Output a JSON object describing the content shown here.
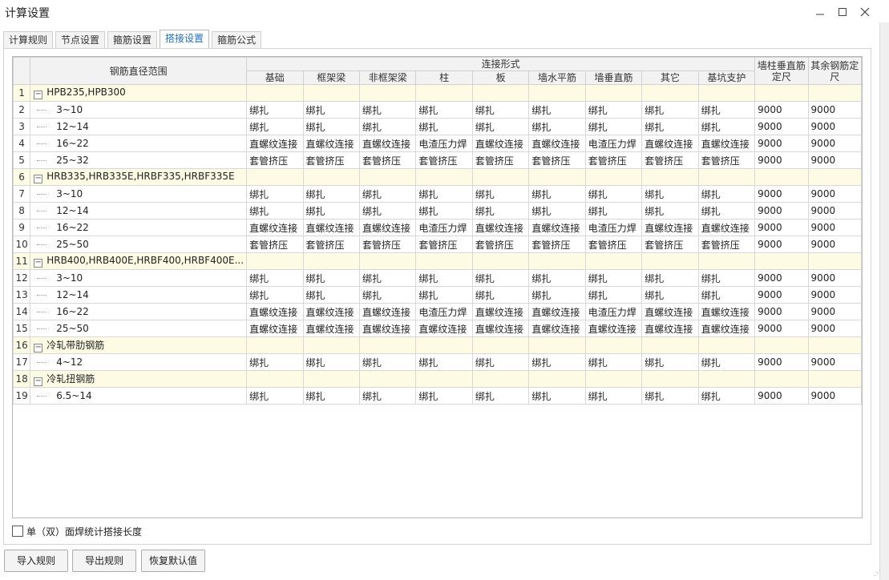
{
  "window": {
    "title": "计算设置"
  },
  "tabs": [
    {
      "label": "计算规则"
    },
    {
      "label": "节点设置"
    },
    {
      "label": "箍筋设置"
    },
    {
      "label": "搭接设置",
      "active": true
    },
    {
      "label": "箍筋公式"
    }
  ],
  "grid": {
    "col_range": "钢筋直径范围",
    "col_connect": "连接形式",
    "sub_headers": [
      "基础",
      "框架梁",
      "非框架梁",
      "柱",
      "板",
      "墙水平筋",
      "墙垂直筋",
      "其它",
      "基坑支护"
    ],
    "col_wall_vertical_length": "墙柱垂直筋定尺",
    "col_other_length": "其余钢筋定尺",
    "rows": [
      {
        "num": "1",
        "group": true,
        "name": "HPB235,HPB300"
      },
      {
        "num": "2",
        "name": "3~10",
        "values": [
          "绑扎",
          "绑扎",
          "绑扎",
          "绑扎",
          "绑扎",
          "绑扎",
          "绑扎",
          "绑扎",
          "绑扎"
        ],
        "len1": "9000",
        "len2": "9000"
      },
      {
        "num": "3",
        "name": "12~14",
        "values": [
          "绑扎",
          "绑扎",
          "绑扎",
          "绑扎",
          "绑扎",
          "绑扎",
          "绑扎",
          "绑扎",
          "绑扎"
        ],
        "len1": "9000",
        "len2": "9000"
      },
      {
        "num": "4",
        "name": "16~22",
        "values": [
          "直螺纹连接",
          "直螺纹连接",
          "直螺纹连接",
          "电渣压力焊",
          "直螺纹连接",
          "直螺纹连接",
          "电渣压力焊",
          "直螺纹连接",
          "直螺纹连接"
        ],
        "len1": "9000",
        "len2": "9000"
      },
      {
        "num": "5",
        "name": "25~32",
        "values": [
          "套管挤压",
          "套管挤压",
          "套管挤压",
          "套管挤压",
          "套管挤压",
          "套管挤压",
          "套管挤压",
          "套管挤压",
          "套管挤压"
        ],
        "len1": "9000",
        "len2": "9000"
      },
      {
        "num": "6",
        "group": true,
        "name": "HRB335,HRB335E,HRBF335,HRBF335E"
      },
      {
        "num": "7",
        "name": "3~10",
        "values": [
          "绑扎",
          "绑扎",
          "绑扎",
          "绑扎",
          "绑扎",
          "绑扎",
          "绑扎",
          "绑扎",
          "绑扎"
        ],
        "len1": "9000",
        "len2": "9000"
      },
      {
        "num": "8",
        "name": "12~14",
        "values": [
          "绑扎",
          "绑扎",
          "绑扎",
          "绑扎",
          "绑扎",
          "绑扎",
          "绑扎",
          "绑扎",
          "绑扎"
        ],
        "len1": "9000",
        "len2": "9000"
      },
      {
        "num": "9",
        "name": "16~22",
        "values": [
          "直螺纹连接",
          "直螺纹连接",
          "直螺纹连接",
          "电渣压力焊",
          "直螺纹连接",
          "直螺纹连接",
          "电渣压力焊",
          "直螺纹连接",
          "直螺纹连接"
        ],
        "len1": "9000",
        "len2": "9000"
      },
      {
        "num": "10",
        "name": "25~50",
        "values": [
          "套管挤压",
          "套管挤压",
          "套管挤压",
          "套管挤压",
          "套管挤压",
          "套管挤压",
          "套管挤压",
          "套管挤压",
          "套管挤压"
        ],
        "len1": "9000",
        "len2": "9000"
      },
      {
        "num": "11",
        "group": true,
        "name": "HRB400,HRB400E,HRBF400,HRBF400E..."
      },
      {
        "num": "12",
        "name": "3~10",
        "values": [
          "绑扎",
          "绑扎",
          "绑扎",
          "绑扎",
          "绑扎",
          "绑扎",
          "绑扎",
          "绑扎",
          "绑扎"
        ],
        "len1": "9000",
        "len2": "9000"
      },
      {
        "num": "13",
        "name": "12~14",
        "values": [
          "绑扎",
          "绑扎",
          "绑扎",
          "绑扎",
          "绑扎",
          "绑扎",
          "绑扎",
          "绑扎",
          "绑扎"
        ],
        "len1": "9000",
        "len2": "9000"
      },
      {
        "num": "14",
        "name": "16~22",
        "values": [
          "直螺纹连接",
          "直螺纹连接",
          "直螺纹连接",
          "电渣压力焊",
          "直螺纹连接",
          "直螺纹连接",
          "电渣压力焊",
          "直螺纹连接",
          "直螺纹连接"
        ],
        "len1": "9000",
        "len2": "9000"
      },
      {
        "num": "15",
        "name": "25~50",
        "values": [
          "直螺纹连接",
          "直螺纹连接",
          "直螺纹连接",
          "直螺纹连接",
          "直螺纹连接",
          "直螺纹连接",
          "直螺纹连接",
          "直螺纹连接",
          "直螺纹连接"
        ],
        "len1": "9000",
        "len2": "9000"
      },
      {
        "num": "16",
        "group": true,
        "name": "冷轧带肋钢筋"
      },
      {
        "num": "17",
        "name": "4~12",
        "values": [
          "绑扎",
          "绑扎",
          "绑扎",
          "绑扎",
          "绑扎",
          "绑扎",
          "绑扎",
          "绑扎",
          "绑扎"
        ],
        "len1": "9000",
        "len2": "9000"
      },
      {
        "num": "18",
        "group": true,
        "name": "冷轧扭钢筋"
      },
      {
        "num": "19",
        "name": "6.5~14",
        "values": [
          "绑扎",
          "绑扎",
          "绑扎",
          "绑扎",
          "绑扎",
          "绑扎",
          "绑扎",
          "绑扎",
          "绑扎"
        ],
        "len1": "9000",
        "len2": "9000"
      }
    ]
  },
  "checkbox": {
    "label": "单（双）面焊统计搭接长度",
    "checked": false
  },
  "buttons": {
    "import": "导入规则",
    "export": "导出规则",
    "restore": "恢复默认值"
  },
  "icons": {
    "minimize": "minimize-icon",
    "maximize": "maximize-icon",
    "close": "close-icon",
    "expander": "collapse-minus-icon"
  },
  "colors": {
    "group_row_bg": "#fdfbe3",
    "active_tab_text": "#1f6fc4"
  }
}
